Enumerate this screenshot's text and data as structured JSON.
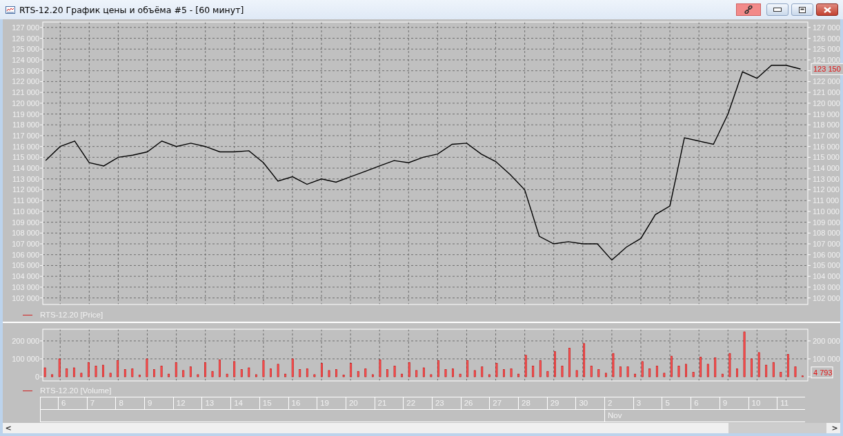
{
  "window": {
    "title": "RTS-12.20 График цены и объёма #5 - [60 минут]"
  },
  "price_panel": {
    "last_value": "123 150",
    "chart_data": {
      "type": "line",
      "grid": true,
      "ylim": [
        101400,
        127500
      ],
      "yticks": [
        {
          "value": 102000,
          "label": "102 000"
        },
        {
          "value": 103000,
          "label": "103 000"
        },
        {
          "value": 104000,
          "label": "104 000"
        },
        {
          "value": 105000,
          "label": "105 000"
        },
        {
          "value": 106000,
          "label": "106 000"
        },
        {
          "value": 107000,
          "label": "107 000"
        },
        {
          "value": 108000,
          "label": "108 000"
        },
        {
          "value": 109000,
          "label": "109 000"
        },
        {
          "value": 110000,
          "label": "110 000"
        },
        {
          "value": 111000,
          "label": "111 000"
        },
        {
          "value": 112000,
          "label": "112 000"
        },
        {
          "value": 113000,
          "label": "113 000"
        },
        {
          "value": 114000,
          "label": "114 000"
        },
        {
          "value": 115000,
          "label": "115 000"
        },
        {
          "value": 116000,
          "label": "116 000"
        },
        {
          "value": 117000,
          "label": "117 000"
        },
        {
          "value": 118000,
          "label": "118 000"
        },
        {
          "value": 119000,
          "label": "119 000"
        },
        {
          "value": 120000,
          "label": "120 000"
        },
        {
          "value": 121000,
          "label": "121 000"
        },
        {
          "value": 122000,
          "label": "122 000"
        },
        {
          "value": 123000,
          "label": "123 000"
        },
        {
          "value": 124000,
          "label": "124 000"
        },
        {
          "value": 125000,
          "label": "125 000"
        },
        {
          "value": 126000,
          "label": "126 000"
        },
        {
          "value": 127000,
          "label": "127 000"
        }
      ],
      "categories": [
        null,
        null,
        null,
        null,
        null,
        null,
        null,
        null,
        null,
        null,
        null,
        null,
        null,
        null,
        null,
        null,
        null,
        null,
        null,
        null,
        null,
        null,
        null,
        null,
        null,
        null,
        null,
        null,
        null,
        null,
        null,
        null,
        null,
        null,
        null,
        null,
        null,
        null,
        null,
        null,
        null,
        null,
        null,
        null,
        null,
        null,
        null,
        null,
        null,
        null,
        null,
        null,
        null
      ],
      "series": [
        {
          "name": "RTS-12.20 [Price]",
          "color": "#000000",
          "values": [
            114700,
            116000,
            116500,
            114500,
            114200,
            115000,
            115200,
            115500,
            116500,
            116000,
            116300,
            116000,
            115500,
            115500,
            115600,
            114500,
            112800,
            113200,
            112500,
            113000,
            112700,
            113200,
            113700,
            114200,
            114700,
            114500,
            115000,
            115300,
            116200,
            116300,
            115300,
            114600,
            113400,
            112000,
            107700,
            107000,
            107200,
            107000,
            107000,
            105500,
            106700,
            107500,
            109700,
            110500,
            116800,
            116500,
            116200,
            119000,
            122900,
            122300,
            123500,
            123500,
            123150
          ]
        }
      ]
    }
  },
  "volume_panel": {
    "last_value": "4 793",
    "chart_data": {
      "type": "bar",
      "grid": true,
      "ylim": [
        -23000,
        265000
      ],
      "categories": [
        null,
        null,
        null,
        null,
        null,
        null,
        null,
        null,
        null,
        null,
        null,
        null,
        null,
        null,
        null,
        null,
        null,
        null,
        null,
        null,
        null,
        null,
        null,
        null,
        null,
        null,
        null,
        null,
        null,
        null,
        null,
        null,
        null,
        null,
        null,
        null,
        null,
        null,
        null,
        null,
        null,
        null,
        null,
        null,
        null,
        null,
        null,
        null,
        null,
        null,
        null,
        null,
        null,
        null,
        null,
        null,
        null,
        null,
        null,
        null,
        null,
        null,
        null,
        null,
        null,
        null,
        null,
        null,
        null,
        null,
        null,
        null,
        null,
        null,
        null,
        null,
        null,
        null,
        null,
        null,
        null,
        null,
        null,
        null,
        null,
        null,
        null,
        null,
        null,
        null,
        null,
        null,
        null,
        null,
        null,
        null,
        null,
        null,
        null,
        null,
        null,
        null,
        null,
        null,
        null
      ],
      "yticks": [
        {
          "value": 0,
          "label": "0"
        },
        {
          "value": 100000,
          "label": "100 000"
        },
        {
          "value": 200000,
          "label": "200 000"
        }
      ],
      "series": [
        {
          "name": "RTS-12.20 [Volume]",
          "color": "#ff5a5a",
          "values": [
            50000,
            12000,
            100000,
            45000,
            50000,
            20000,
            80000,
            60000,
            65000,
            20000,
            90000,
            40000,
            45000,
            10000,
            100000,
            40000,
            60000,
            15000,
            80000,
            35000,
            55000,
            12000,
            80000,
            30000,
            94000,
            15000,
            85000,
            40000,
            50000,
            12000,
            90000,
            45000,
            70000,
            15000,
            100000,
            40000,
            45000,
            12000,
            75000,
            35000,
            40000,
            10000,
            75000,
            30000,
            45000,
            12000,
            95000,
            40000,
            60000,
            15000,
            80000,
            35000,
            50000,
            12000,
            90000,
            40000,
            45000,
            15000,
            90000,
            35000,
            55000,
            12000,
            75000,
            40000,
            45000,
            15000,
            120000,
            60000,
            90000,
            30000,
            140000,
            60000,
            160000,
            35000,
            185000,
            60000,
            40000,
            20000,
            130000,
            55000,
            55000,
            15000,
            85000,
            45000,
            60000,
            20000,
            115000,
            60000,
            70000,
            25000,
            110000,
            70000,
            105000,
            15000,
            130000,
            45000,
            250000,
            100000,
            135000,
            65000,
            80000,
            25000,
            125000,
            55000,
            5000
          ]
        }
      ]
    }
  },
  "date_axis": [
    {
      "day": "6"
    },
    {
      "day": "7"
    },
    {
      "day": "8"
    },
    {
      "day": "9"
    },
    {
      "day": "12"
    },
    {
      "day": "13"
    },
    {
      "day": "14"
    },
    {
      "day": "15"
    },
    {
      "day": "16"
    },
    {
      "day": "19"
    },
    {
      "day": "20"
    },
    {
      "day": "21"
    },
    {
      "day": "22"
    },
    {
      "day": "23"
    },
    {
      "day": "26"
    },
    {
      "day": "27"
    },
    {
      "day": "28"
    },
    {
      "day": "29"
    },
    {
      "day": "30"
    },
    {
      "day": "2",
      "month": "Nov"
    },
    {
      "day": "3"
    },
    {
      "day": "5"
    },
    {
      "day": "6"
    },
    {
      "day": "9"
    },
    {
      "day": "10"
    },
    {
      "day": "11"
    }
  ],
  "scrollbar": {
    "left_arrow": "<",
    "right_arrow": ">"
  }
}
